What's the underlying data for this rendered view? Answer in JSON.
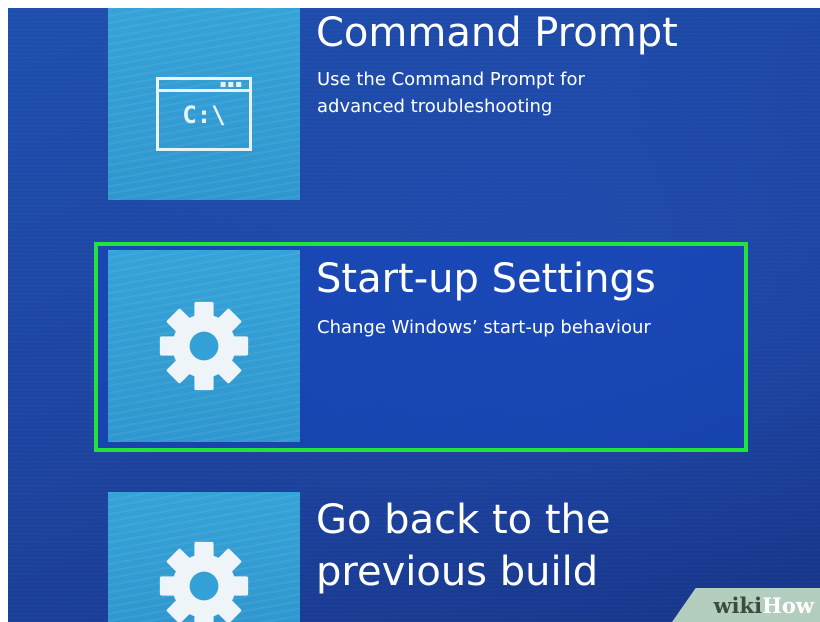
{
  "options": [
    {
      "title": "Command Prompt",
      "description_lines": [
        "Use the Command Prompt for",
        "advanced troubleshooting"
      ],
      "icon": "command-prompt-icon",
      "icon_text": "C:\\"
    },
    {
      "title": "Start-up Settings",
      "description_lines": [
        "Change Windows’ start-up behaviour"
      ],
      "icon": "gear-icon",
      "highlighted": true
    },
    {
      "title": "Go back to the previous build",
      "icon": "gear-icon"
    }
  ],
  "watermark": {
    "part1": "wiki",
    "part2": "How"
  },
  "colors": {
    "background": "#1d46a3",
    "tile": "#35a3d8",
    "highlight_border": "#22e23b",
    "text": "#ffffff"
  }
}
